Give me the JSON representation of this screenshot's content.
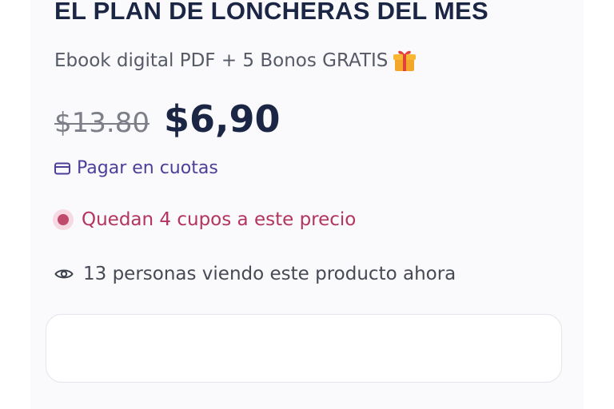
{
  "product": {
    "title": "EL PLAN DE LONCHERAS DEL MES",
    "subtitle": "Ebook digital PDF + 5 Bonos GRATIS",
    "subtitle_icon": "gift-icon",
    "old_price": "$13.80",
    "new_price": "$6,90",
    "installments_label": "Pagar en cuotas",
    "installments_icon": "credit-card-icon",
    "stock_message": "Quedan 4 cupos a este precio",
    "viewers_message": "13 personas viendo este producto ahora",
    "viewers_icon": "eye-icon"
  },
  "colors": {
    "title": "#1b2645",
    "installments": "#4b3f9a",
    "stock": "#b3345c",
    "old_price": "#7c7f87"
  }
}
